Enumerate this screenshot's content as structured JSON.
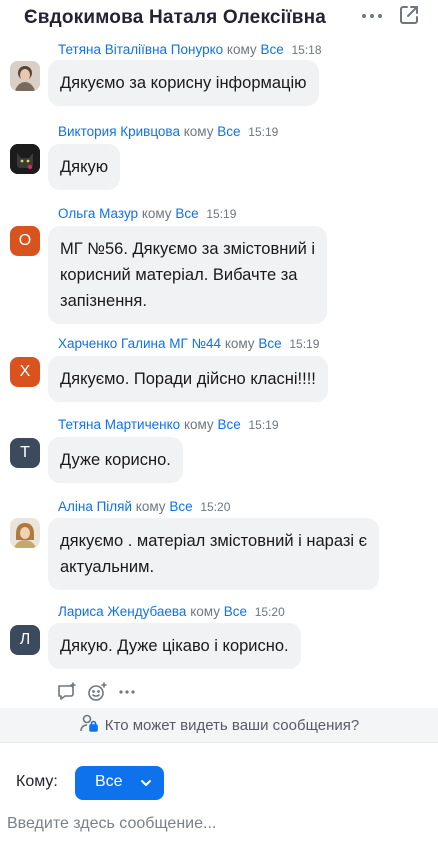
{
  "header": {
    "title": "Євдокимова Наталя Олексіївна",
    "more_icon": "more-dots-icon",
    "popout_icon": "popout-icon"
  },
  "messages": [
    {
      "sender": "Тетяна Віталіївна Понурко",
      "to": "кому",
      "recipient": "Все",
      "time": "15:18",
      "text": "Дякуємо за корисну інформацію",
      "avatar": "photo"
    },
    {
      "sender": "Виктория Кривцова",
      "to": "кому",
      "recipient": "Все",
      "time": "15:19",
      "text": "Дякую",
      "avatar": "photo"
    },
    {
      "sender": "Ольга Мазур",
      "to": "кому",
      "recipient": "Все",
      "time": "15:19",
      "text_lines": [
        "МГ №56. Дякуємо  за змістовний і",
        "корисний матеріал. Вибачте за",
        "запізнення."
      ],
      "avatar": "О",
      "avatar_color": "#d9531e"
    },
    {
      "sender": "Харченко Галина МГ №44",
      "to": "кому",
      "recipient": "Все",
      "time": "15:19",
      "text": "Дякуємо. Поради дійсно класні!!!!",
      "avatar": "Х",
      "avatar_color": "#d9531e"
    },
    {
      "sender": "Тетяна Мартиченко",
      "to": "кому",
      "recipient": "Все",
      "time": "15:19",
      "text": "Дуже корисно.",
      "avatar": "Т",
      "avatar_color": "#3b4a5c"
    },
    {
      "sender": "Аліна Піляй",
      "to": "кому",
      "recipient": "Все",
      "time": "15:20",
      "text_lines": [
        "дякуємо . матеріал змістовний і наразі є",
        "актуальним."
      ],
      "avatar": "photo"
    },
    {
      "sender": "Лариса Жендубаева",
      "to": "кому",
      "recipient": "Все",
      "time": "15:20",
      "text": "Дякую. Дуже цікаво і корисно.",
      "avatar": "Л",
      "avatar_color": "#3b4a5c"
    }
  ],
  "actions": [
    "reply-icon",
    "emoji-icon",
    "more-icon"
  ],
  "privacy": {
    "text": "Кто может видеть ваши сообщения?",
    "icon": "user-lock-icon"
  },
  "to_row": {
    "label": "Кому:",
    "selected": "Все"
  },
  "compose": {
    "placeholder": "Введите здесь сообщение..."
  },
  "colors": {
    "accent": "#0e72ed",
    "bubble": "#f1f2f4",
    "orange_avatar": "#d9531e",
    "slate_avatar": "#3b4a5c"
  }
}
